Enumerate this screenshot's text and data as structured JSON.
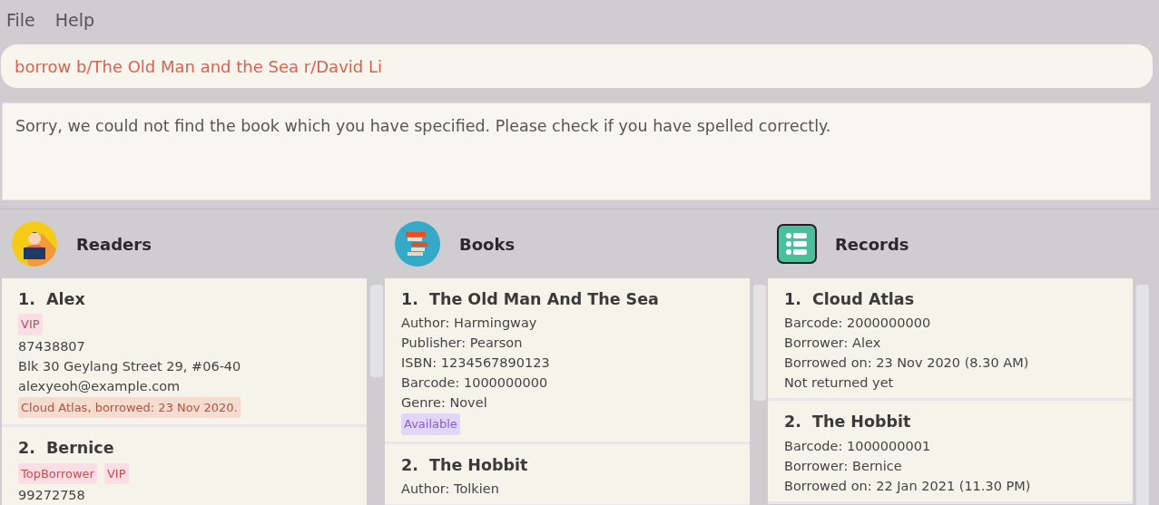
{
  "menu": [
    "File",
    "Help"
  ],
  "command": {
    "value": "borrow b/The Old Man and the Sea r/David Li"
  },
  "result": {
    "text": "Sorry, we could not find the book which you have specified. Please check if you have spelled correctly."
  },
  "panels": [
    {
      "kind": "readers",
      "title": "Readers",
      "items": [
        {
          "number": "1.",
          "title": "Alex",
          "tags": [
            {
              "label": "VIP",
              "kind": "tag"
            }
          ],
          "lines": [
            "87438807",
            "Blk 30 Geylang Street 29, #06-40",
            "alexyeoh@example.com"
          ],
          "badges": [
            {
              "label": "Cloud Atlas, borrowed: 23 Nov 2020.",
              "kind": "loan"
            }
          ]
        },
        {
          "number": "2.",
          "title": "Bernice",
          "tags": [
            {
              "label": "TopBorrower",
              "kind": "tag"
            },
            {
              "label": "VIP",
              "kind": "tag"
            }
          ],
          "lines": [
            "99272758"
          ]
        }
      ]
    },
    {
      "kind": "books",
      "title": "Books",
      "items": [
        {
          "number": "1.",
          "title": "The Old Man And The Sea",
          "lines": [
            "Author: Harmingway",
            "Publisher: Pearson",
            "ISBN: 1234567890123",
            "Barcode: 1000000000",
            "Genre: Novel"
          ],
          "badges": [
            {
              "label": "Available",
              "kind": "available"
            }
          ]
        },
        {
          "number": "2.",
          "title": "The Hobbit",
          "lines": [
            "Author: Tolkien"
          ]
        }
      ]
    },
    {
      "kind": "records",
      "title": "Records",
      "items": [
        {
          "number": "1.",
          "title": "Cloud Atlas",
          "lines": [
            "Barcode: 2000000000",
            "Borrower: Alex",
            "Borrowed on: 23 Nov 2020 (8.30 AM)",
            "Not returned yet"
          ]
        },
        {
          "number": "2.",
          "title": "The Hobbit",
          "lines": [
            "Barcode: 1000000001",
            "Borrower: Bernice",
            "Borrowed on: 22 Jan 2021 (11.30 PM)"
          ]
        }
      ]
    }
  ]
}
